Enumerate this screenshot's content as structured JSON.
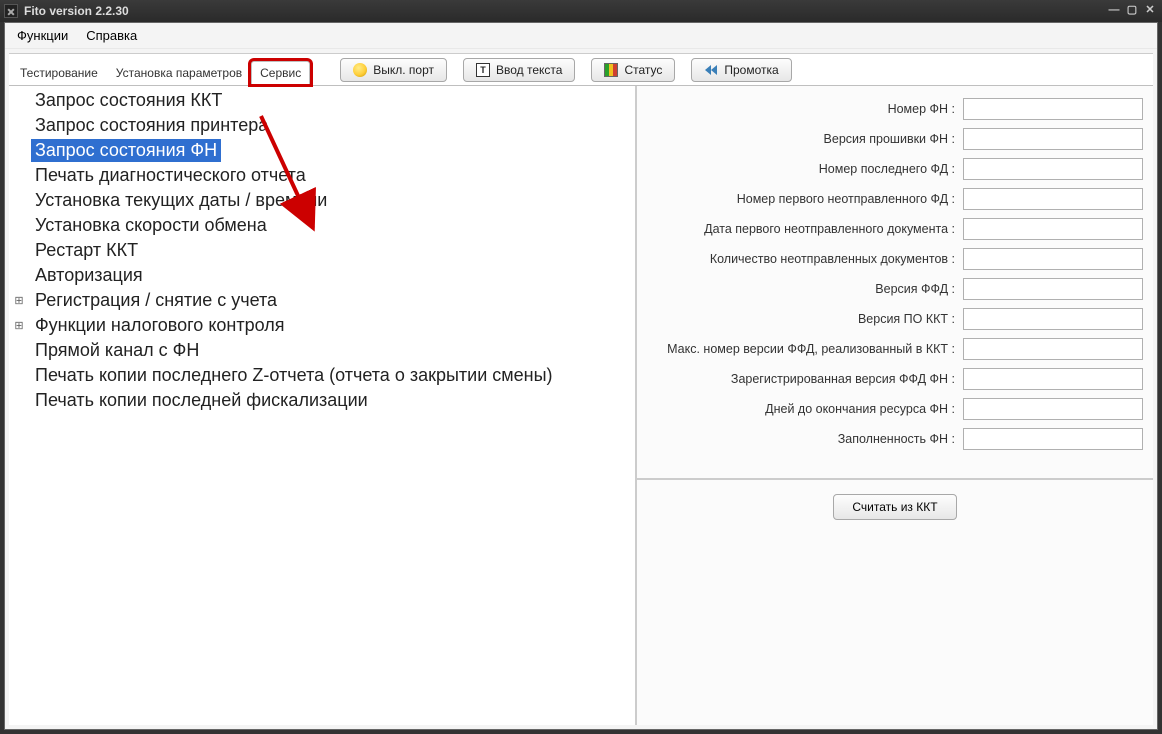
{
  "window": {
    "title": "Fito version 2.2.30"
  },
  "menubar": {
    "items": [
      "Функции",
      "Справка"
    ]
  },
  "tabs": [
    "Тестирование",
    "Установка параметров",
    "Сервис"
  ],
  "active_tab_index": 2,
  "toolbar": {
    "btn_port": "Выкл. порт",
    "btn_text": "Ввод текста",
    "btn_status": "Статус",
    "btn_rewind": "Промотка"
  },
  "tree": [
    {
      "label": "Запрос состояния ККТ",
      "expandable": false,
      "selected": false
    },
    {
      "label": "Запрос состояния принтера",
      "expandable": false,
      "selected": false
    },
    {
      "label": "Запрос состояния ФН",
      "expandable": false,
      "selected": true
    },
    {
      "label": "Печать диагностического отчета",
      "expandable": false,
      "selected": false
    },
    {
      "label": "Установка текущих даты / времени",
      "expandable": false,
      "selected": false
    },
    {
      "label": "Установка скорости обмена",
      "expandable": false,
      "selected": false
    },
    {
      "label": "Рестарт ККТ",
      "expandable": false,
      "selected": false
    },
    {
      "label": "Авторизация",
      "expandable": false,
      "selected": false
    },
    {
      "label": "Регистрация / снятие с учета",
      "expandable": true,
      "selected": false
    },
    {
      "label": "Функции налогового контроля",
      "expandable": true,
      "selected": false
    },
    {
      "label": "Прямой канал с ФН",
      "expandable": false,
      "selected": false
    },
    {
      "label": "Печать копии последнего Z-отчета (отчета о закрытии смены)",
      "expandable": false,
      "selected": false
    },
    {
      "label": "Печать копии последней фискализации",
      "expandable": false,
      "selected": false
    }
  ],
  "form": {
    "fields": [
      {
        "label": "Номер ФН :",
        "value": ""
      },
      {
        "label": "Версия прошивки ФН :",
        "value": ""
      },
      {
        "label": "Номер последнего ФД :",
        "value": ""
      },
      {
        "label": "Номер первого неотправленного ФД :",
        "value": ""
      },
      {
        "label": "Дата первого неотправленного документа :",
        "value": ""
      },
      {
        "label": "Количество неотправленных документов :",
        "value": ""
      },
      {
        "label": "Версия ФФД :",
        "value": ""
      },
      {
        "label": "Версия ПО ККТ :",
        "value": ""
      },
      {
        "label": "Макс. номер версии ФФД, реализованный в ККТ :",
        "value": ""
      },
      {
        "label": "Зарегистрированная версия ФФД ФН :",
        "value": ""
      },
      {
        "label": "Дней до окончания ресурса ФН :",
        "value": ""
      },
      {
        "label": "Заполненность ФН :",
        "value": ""
      }
    ],
    "read_button": "Считать из ККТ"
  },
  "annotation": {
    "highlight_tab_index": 2
  }
}
